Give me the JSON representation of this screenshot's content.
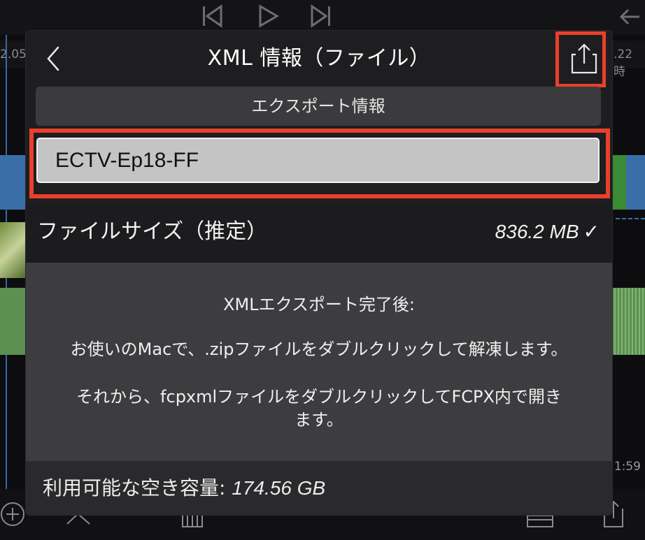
{
  "colors": {
    "highlight": "#e8402a",
    "modal_bg": "#1e1e20",
    "field_bg": "#c4c4c4"
  },
  "background": {
    "transport_icons": [
      "skip-back-icon",
      "play-icon",
      "skip-forward-icon"
    ],
    "ruler_left": "2.05",
    "ruler_right": ".22 時",
    "time_right": "1:59",
    "toolbar_icons": [
      "add-icon",
      "scissors-icon",
      "clip-icon",
      "layers-icon",
      "share-icon"
    ]
  },
  "modal": {
    "title": "XML 情報（ファイル）",
    "back_icon": "chevron-left-icon",
    "share_icon": "share-icon",
    "section_header": "エクスポート情報",
    "file_name": "ECTV-Ep18-FF",
    "size_label": "ファイルサイズ（推定）",
    "size_value": "836.2 MB",
    "size_check": "✓",
    "info": {
      "line1": "XMLエクスポート完了後:",
      "line2": "お使いのMacで、.zipファイルをダブルクリックして解凍します。",
      "line3a": "それから、fcpxmlファイルをダブルクリックしてFCPX内で開き",
      "line3b": "ます。"
    },
    "footer_label": "利用可能な空き容量:",
    "footer_value": "174.56 GB"
  }
}
